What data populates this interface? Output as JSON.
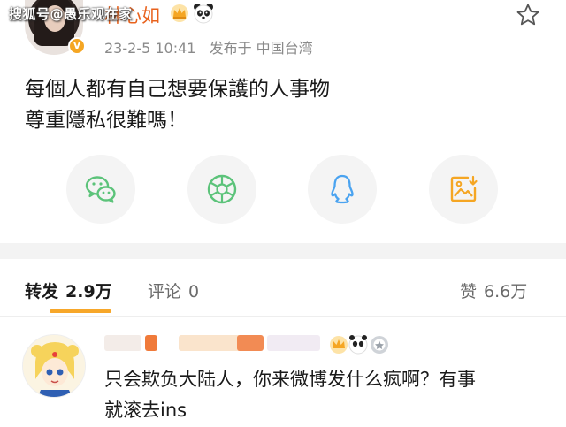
{
  "watermark": "搜狐号@愚乐观在家",
  "post": {
    "author_name": "林心如",
    "verified_badge": "V",
    "date": "23-2-5 10:41",
    "published_from": "发布于 中国台湾",
    "content_lines": [
      "每個人都有自己想要保護的人事物",
      "尊重隱私很難嗎！"
    ],
    "icons": [
      "crown-icon",
      "panda-icon",
      "star-icon"
    ]
  },
  "share": {
    "buttons": [
      "wechat-icon",
      "moments-icon",
      "qq-icon",
      "save-image-icon"
    ],
    "colors": {
      "wechat": "#5cc37a",
      "moments": "#5cc37a",
      "qq": "#4aa3f0",
      "save": "#f5a623"
    }
  },
  "tabs": {
    "repost_label": "转发",
    "repost_count": "2.9万",
    "comment_label": "评论",
    "comment_count": "0",
    "like_label": "赞",
    "like_count": "6.6万",
    "accent": "#f7a72a"
  },
  "comment": {
    "text_line1": "只会欺负大陆人，你来微博发什么疯啊？有事",
    "text_line2": "就滚去ins"
  }
}
